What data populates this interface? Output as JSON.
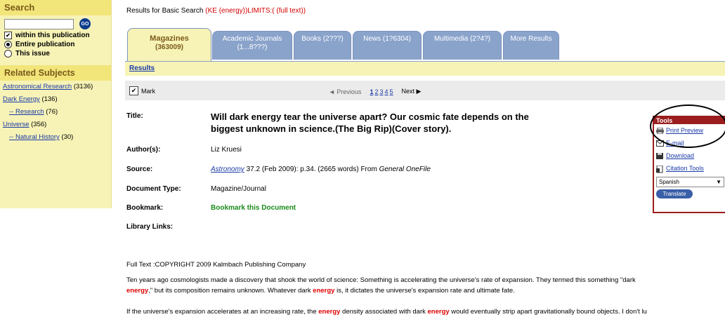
{
  "sidebar": {
    "search_heading": "Search",
    "search_input_value": "",
    "go_label": "GO",
    "options": [
      {
        "label": "within this publication",
        "type": "checkbox",
        "checked": true
      },
      {
        "label": "Entire publication",
        "type": "radio",
        "checked": true
      },
      {
        "label": "This issue",
        "type": "radio",
        "checked": false
      }
    ],
    "related_heading": "Related Subjects",
    "related": [
      {
        "label": "Astronomical Research",
        "count": "(3136)",
        "sub": false
      },
      {
        "label": "Dark Energy",
        "count": "(136)",
        "sub": false
      },
      {
        "label": "-- Research",
        "count": "(76)",
        "sub": true
      },
      {
        "label": "Universe",
        "count": "(356)",
        "sub": false
      },
      {
        "label": "-- Natural History",
        "count": "(30)",
        "sub": true
      }
    ]
  },
  "results_line": {
    "prefix": "Results for Basic Search",
    "query": "(KE (energy))LIMITS:( (full text))"
  },
  "tabs": [
    {
      "label": "Magazines",
      "count": "(363009)",
      "active": true
    },
    {
      "label": "Academic Journals",
      "count": "(1...8???)",
      "active": false
    },
    {
      "label": "Books (2???)",
      "count": "",
      "active": false
    },
    {
      "label": "News (1?6304)",
      "count": "",
      "active": false
    },
    {
      "label": "Multimedia (2?4?)",
      "count": "",
      "active": false
    },
    {
      "label": "More Results",
      "count": "",
      "active": false
    }
  ],
  "results_link": "Results",
  "mark_label": "Mark",
  "pager": {
    "prev": "◄ Previous",
    "pages": [
      "1",
      "2",
      "3",
      "4",
      "5"
    ],
    "next": "Next ▶"
  },
  "record": {
    "title_label": "Title:",
    "title": "Will dark energy tear the universe apart? Our cosmic fate depends on the biggest unknown in science.(The Big Rip)(Cover story).",
    "author_label": "Author(s):",
    "author": "Liz Kruesi",
    "source_label": "Source:",
    "source_pub": "Astronomy",
    "source_rest": " 37.2 (Feb 2009): p.34. (2665 words) From ",
    "source_db": "General OneFile",
    "doctype_label": "Document Type:",
    "doctype": "Magazine/Journal",
    "bookmark_label": "Bookmark:",
    "bookmark_link": "Bookmark this Document",
    "library_label": "Library Links:"
  },
  "tools": {
    "heading": "Tools",
    "items": [
      {
        "label": "Print Preview",
        "icon": "printer-icon"
      },
      {
        "label": "E-mail",
        "icon": "envelope-icon"
      },
      {
        "label": "Download",
        "icon": "disk-icon"
      },
      {
        "label": "Citation Tools",
        "icon": "document-icon"
      }
    ],
    "language": "Spanish",
    "translate": "Translate"
  },
  "fulltext": {
    "heading": "Full Text :COPYRIGHT 2009 Kalmbach Publishing Company",
    "p1a": "Ten years ago cosmologists made a discovery that shook the world of science: Something is accelerating the universe's rate of expansion. They termed this something \"dark",
    "p1b_hl": "energy",
    "p1c": ",\" but its composition remains unknown. Whatever dark ",
    "p1d_hl": "energy",
    "p1e": " is, it dictates the universe's expansion rate and ultimate fate.",
    "p2a": "If the universe's expansion accelerates at an increasing rate, the ",
    "p2b_hl": "energy",
    "p2c": " density associated with dark ",
    "p2d_hl": "energy",
    "p2e": " would eventually strip apart gravitationally bound objects. I don't lu"
  },
  "colors": {
    "accent_red": "#d10000",
    "link_blue": "#1a3aa8",
    "sidebar_bg": "#f7f3b6",
    "tab_blue": "#8aa3cb",
    "tools_red": "#9b1d1d",
    "bookmark_green": "#1a8a1a"
  }
}
